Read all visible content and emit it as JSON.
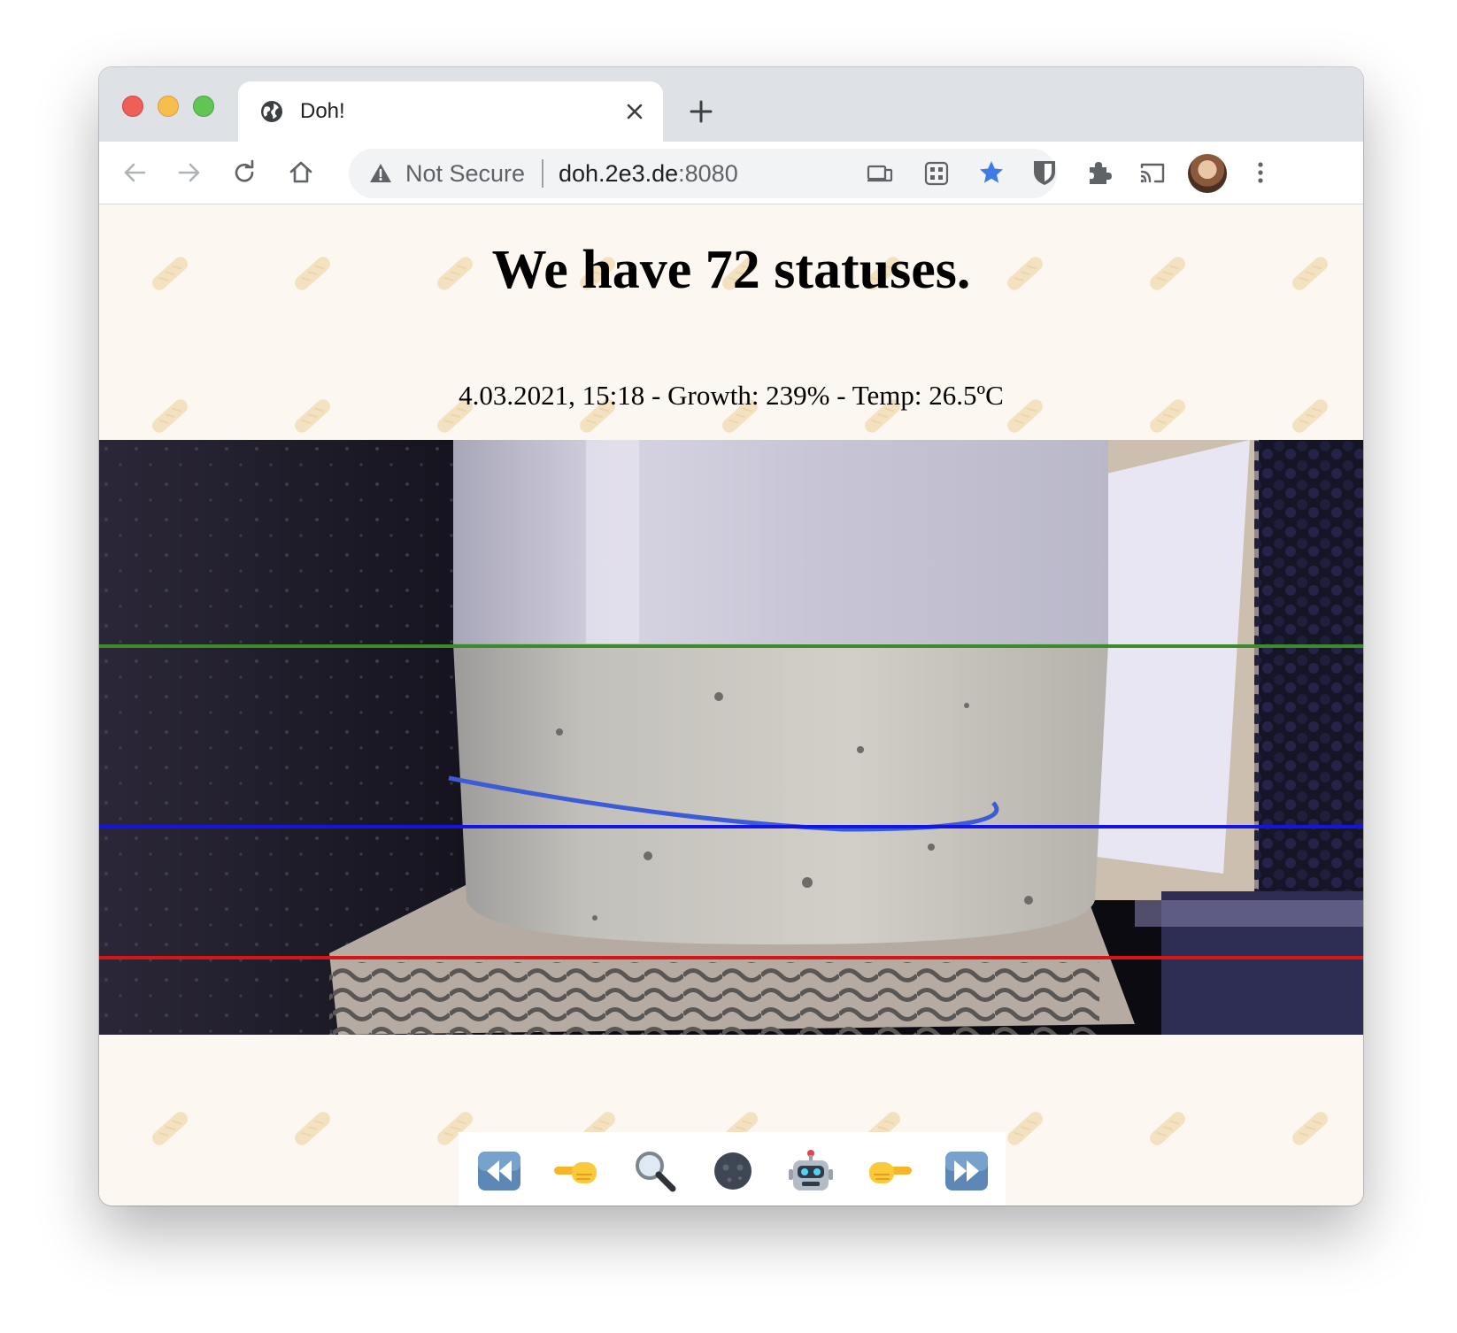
{
  "browser": {
    "tab": {
      "title": "Doh!"
    },
    "address_bar": {
      "security_label": "Not Secure",
      "host": "doh.2e3.de",
      "port": ":8080"
    }
  },
  "page": {
    "headline": "We have 72 statuses.",
    "status": "4.03.2021, 15:18 - Growth: 239% - Temp: 26.5ºC",
    "controls": [
      {
        "name": "rewind-button",
        "icon": "fast-reverse-icon"
      },
      {
        "name": "previous-button",
        "icon": "hand-pointing-left-icon"
      },
      {
        "name": "zoom-button",
        "icon": "magnifying-glass-icon"
      },
      {
        "name": "dark-mode-button",
        "icon": "new-moon-face-icon"
      },
      {
        "name": "robot-button",
        "icon": "robot-icon"
      },
      {
        "name": "next-button",
        "icon": "hand-pointing-right-icon"
      },
      {
        "name": "fast-forward-button",
        "icon": "fast-forward-icon"
      }
    ]
  },
  "colors": {
    "page_background": "#fcf8f1",
    "bookmark_star": "#3f7be8",
    "line_top": "#3d8a2a",
    "line_middle": "#1414e6",
    "line_bottom": "#d81414"
  }
}
